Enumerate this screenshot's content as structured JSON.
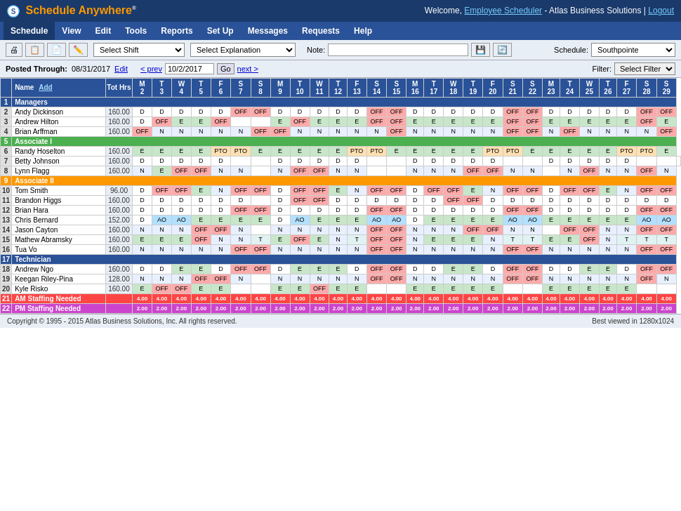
{
  "header": {
    "logo_text": "Schedule Anywhere",
    "logo_symbol": "®",
    "welcome_text": "Welcome,",
    "employee_scheduler": "Employee Scheduler",
    "company": "Atlas Business Solutions",
    "logout": "Logout"
  },
  "nav": {
    "items": [
      "Schedule",
      "View",
      "Edit",
      "Tools",
      "Reports",
      "Set Up",
      "Messages",
      "Requests",
      "Help"
    ]
  },
  "toolbar": {
    "shift_placeholder": "Select Shift",
    "explanation_placeholder": "Select Explanation",
    "note_label": "Note:",
    "icons": [
      "print-icon",
      "copy-icon",
      "paste-icon",
      "edit-icon"
    ]
  },
  "posted": {
    "label": "Posted Through:",
    "date": "08/31/2017",
    "edit": "Edit",
    "prev": "< prev",
    "current_date": "10/2/2017",
    "next": "next >",
    "go": "Go"
  },
  "schedule_section": {
    "label": "Schedule:",
    "value": "Southpointe"
  },
  "filter": {
    "label": "Filter:",
    "placeholder": "Select Filter"
  },
  "table": {
    "headers": {
      "name": "Name",
      "add": "Add",
      "tot_hrs": "Tot Hrs",
      "days": [
        {
          "day": "M",
          "date": "2"
        },
        {
          "day": "T",
          "date": "3"
        },
        {
          "day": "W",
          "date": "4"
        },
        {
          "day": "T",
          "date": "5"
        },
        {
          "day": "F",
          "date": "6"
        },
        {
          "day": "S",
          "date": "7"
        },
        {
          "day": "S",
          "date": "8"
        },
        {
          "day": "M",
          "date": "9"
        },
        {
          "day": "T",
          "date": "10"
        },
        {
          "day": "W",
          "date": "11"
        },
        {
          "day": "T",
          "date": "12"
        },
        {
          "day": "F",
          "date": "13"
        },
        {
          "day": "S",
          "date": "14"
        },
        {
          "day": "S",
          "date": "15"
        },
        {
          "day": "M",
          "date": "16"
        },
        {
          "day": "T",
          "date": "17"
        },
        {
          "day": "W",
          "date": "18"
        },
        {
          "day": "T",
          "date": "19"
        },
        {
          "day": "F",
          "date": "20"
        },
        {
          "day": "S",
          "date": "21"
        },
        {
          "day": "S",
          "date": "22"
        },
        {
          "day": "M",
          "date": "23"
        },
        {
          "day": "T",
          "date": "24"
        },
        {
          "day": "W",
          "date": "25"
        },
        {
          "day": "T",
          "date": "26"
        },
        {
          "day": "F",
          "date": "27"
        },
        {
          "day": "S",
          "date": "28"
        },
        {
          "day": "S",
          "date": "29"
        }
      ]
    },
    "sections": [
      {
        "type": "section",
        "label": "Managers",
        "color": "#2a5298"
      },
      {
        "type": "employee",
        "num": 2,
        "name": "Andy Dickinson",
        "tot_hrs": "160.00",
        "cells": [
          "D",
          "D",
          "D",
          "D",
          "D",
          "OFF",
          "OFF",
          "D",
          "D",
          "D",
          "D",
          "D",
          "OFF",
          "OFF",
          "D",
          "D",
          "D",
          "D",
          "D",
          "OFF",
          "OFF",
          "D",
          "D",
          "D",
          "D",
          "D",
          "OFF",
          "OFF"
        ]
      },
      {
        "type": "employee",
        "num": 3,
        "name": "Andrew Hilton",
        "tot_hrs": "160.00",
        "cells": [
          "D",
          "OFF",
          "E",
          "E",
          "OFF",
          "",
          "",
          "E",
          "OFF",
          "E",
          "E",
          "E",
          "OFF",
          "OFF",
          "E",
          "E",
          "E",
          "E",
          "E",
          "OFF",
          "OFF",
          "E",
          "E",
          "E",
          "E",
          "E",
          "OFF",
          "E"
        ]
      },
      {
        "type": "employee",
        "num": 4,
        "name": "Brian Arffman",
        "tot_hrs": "160.00",
        "cells": [
          "OFF",
          "N",
          "N",
          "N",
          "N",
          "N",
          "OFF",
          "OFF",
          "N",
          "N",
          "N",
          "N",
          "N",
          "OFF",
          "N",
          "N",
          "N",
          "N",
          "N",
          "OFF",
          "OFF",
          "N",
          "OFF",
          "N",
          "N",
          "N",
          "N",
          "OFF"
        ]
      },
      {
        "type": "section",
        "label": "Associate I",
        "color": "#4caf50"
      },
      {
        "type": "employee",
        "num": 6,
        "name": "Randy Hoselton",
        "tot_hrs": "160.00",
        "cells": [
          "E",
          "E",
          "E",
          "E",
          "PTO",
          "PTO",
          "E",
          "E",
          "E",
          "E",
          "E",
          "PTO",
          "PTO",
          "E",
          "E",
          "E",
          "E",
          "E",
          "PTO",
          "PTO",
          "E",
          "E",
          "E",
          "E",
          "E",
          "PTO",
          "PTO",
          "E"
        ]
      },
      {
        "type": "employee",
        "num": 7,
        "name": "Betty Johnson",
        "tot_hrs": "160.00",
        "cells": [
          "D",
          "D",
          "D",
          "D",
          "D",
          "",
          "",
          "D",
          "D",
          "D",
          "D",
          "D",
          "",
          "",
          "D",
          "D",
          "D",
          "D",
          "D",
          "",
          "",
          "D",
          "D",
          "D",
          "D",
          "D",
          "",
          "",
          ""
        ]
      },
      {
        "type": "employee",
        "num": 8,
        "name": "Lynn Flagg",
        "tot_hrs": "160.00",
        "cells": [
          "N",
          "E",
          "OFF",
          "OFF",
          "N",
          "N",
          "",
          "N",
          "OFF",
          "OFF",
          "N",
          "N",
          "",
          "",
          "N",
          "N",
          "N",
          "OFF",
          "OFF",
          "N",
          "N",
          "",
          "N",
          "OFF",
          "N",
          "N",
          "OFF",
          "N"
        ]
      },
      {
        "type": "section",
        "label": "Associate II",
        "color": "#ff9800"
      },
      {
        "type": "employee",
        "num": 10,
        "name": "Tom Smith",
        "tot_hrs": "96.00",
        "cells": [
          "D",
          "OFF",
          "OFF",
          "E",
          "N",
          "OFF",
          "OFF",
          "D",
          "OFF",
          "OFF",
          "E",
          "N",
          "OFF",
          "OFF",
          "D",
          "OFF",
          "OFF",
          "E",
          "N",
          "OFF",
          "OFF",
          "D",
          "OFF",
          "OFF",
          "E",
          "N",
          "OFF",
          "OFF"
        ]
      },
      {
        "type": "employee",
        "num": 11,
        "name": "Brandon Higgs",
        "tot_hrs": "160.00",
        "cells": [
          "D",
          "D",
          "D",
          "D",
          "D",
          "D",
          "",
          "D",
          "OFF",
          "OFF",
          "D",
          "D",
          "D",
          "D",
          "D",
          "D",
          "OFF",
          "OFF",
          "D",
          "D",
          "D",
          "D",
          "D",
          "D",
          "D",
          "D",
          "D",
          "D"
        ]
      },
      {
        "type": "employee",
        "num": 12,
        "name": "Brian Hara",
        "tot_hrs": "160.00",
        "cells": [
          "D",
          "D",
          "D",
          "D",
          "D",
          "OFF",
          "OFF",
          "D",
          "D",
          "D",
          "D",
          "D",
          "OFF",
          "OFF",
          "D",
          "D",
          "D",
          "D",
          "D",
          "OFF",
          "OFF",
          "D",
          "D",
          "D",
          "D",
          "D",
          "OFF",
          "OFF"
        ]
      },
      {
        "type": "employee",
        "num": 13,
        "name": "Chris Bernard",
        "tot_hrs": "152.00",
        "cells": [
          "D",
          "AO",
          "AO",
          "E",
          "E",
          "E",
          "E",
          "D",
          "AO",
          "E",
          "E",
          "E",
          "AO",
          "AO",
          "D",
          "E",
          "E",
          "E",
          "E",
          "AO",
          "AO",
          "E",
          "E",
          "E",
          "E",
          "E",
          "AO",
          "AO"
        ]
      },
      {
        "type": "employee",
        "num": 14,
        "name": "Jason Cayton",
        "tot_hrs": "160.00",
        "cells": [
          "N",
          "N",
          "N",
          "OFF",
          "OFF",
          "N",
          "",
          "N",
          "N",
          "N",
          "N",
          "N",
          "OFF",
          "OFF",
          "N",
          "N",
          "N",
          "OFF",
          "OFF",
          "N",
          "N",
          "",
          "OFF",
          "OFF",
          "N",
          "N",
          "OFF",
          "OFF"
        ]
      },
      {
        "type": "employee",
        "num": 15,
        "name": "Mathew Abramsky",
        "tot_hrs": "160.00",
        "cells": [
          "E",
          "E",
          "E",
          "OFF",
          "N",
          "N",
          "T",
          "E",
          "OFF",
          "E",
          "N",
          "T",
          "OFF",
          "OFF",
          "N",
          "E",
          "E",
          "E",
          "N",
          "T",
          "T",
          "E",
          "E",
          "OFF",
          "N",
          "T",
          "T",
          "T"
        ]
      },
      {
        "type": "employee",
        "num": 16,
        "name": "Tua Vo",
        "tot_hrs": "160.00",
        "cells": [
          "N",
          "N",
          "N",
          "N",
          "N",
          "OFF",
          "OFF",
          "N",
          "N",
          "N",
          "N",
          "N",
          "OFF",
          "OFF",
          "N",
          "N",
          "N",
          "N",
          "N",
          "OFF",
          "OFF",
          "N",
          "N",
          "N",
          "N",
          "N",
          "OFF",
          "OFF"
        ]
      },
      {
        "type": "section",
        "label": "Technician",
        "color": "#2a5298"
      },
      {
        "type": "employee",
        "num": 18,
        "name": "Andrew Ngo",
        "tot_hrs": "160.00",
        "cells": [
          "D",
          "D",
          "E",
          "E",
          "D",
          "OFF",
          "OFF",
          "D",
          "E",
          "E",
          "E",
          "D",
          "OFF",
          "OFF",
          "D",
          "D",
          "E",
          "E",
          "D",
          "OFF",
          "OFF",
          "D",
          "D",
          "E",
          "E",
          "D",
          "OFF",
          "OFF"
        ]
      },
      {
        "type": "employee",
        "num": 19,
        "name": "Keegan Riley-Pina",
        "tot_hrs": "128.00",
        "cells": [
          "N",
          "N",
          "N",
          "OFF",
          "OFF",
          "N",
          "",
          "N",
          "N",
          "N",
          "N",
          "N",
          "OFF",
          "OFF",
          "N",
          "N",
          "N",
          "N",
          "N",
          "OFF",
          "OFF",
          "N",
          "N",
          "N",
          "N",
          "N",
          "OFF",
          "N"
        ]
      },
      {
        "type": "employee",
        "num": 20,
        "name": "Kyle Risko",
        "tot_hrs": "160.00",
        "cells": [
          "E",
          "OFF",
          "OFF",
          "E",
          "E",
          "",
          "",
          "E",
          "E",
          "OFF",
          "E",
          "E",
          "",
          "",
          "E",
          "E",
          "E",
          "E",
          "E",
          "",
          "",
          "E",
          "E",
          "E",
          "E",
          "E",
          "",
          ""
        ]
      }
    ],
    "staffing_rows": {
      "am_label": "AM Staffing Needed",
      "pm_label": "PM Staffing Needed",
      "am_num": 21,
      "pm_num": 22,
      "am_values": [
        "4.00",
        "4.00",
        "4.00",
        "4.00",
        "4.00",
        "4.00",
        "4.00",
        "4.00",
        "4.00",
        "4.00",
        "4.00",
        "4.00",
        "4.00",
        "4.00",
        "4.00",
        "4.00",
        "4.00",
        "4.00",
        "4.00",
        "4.00",
        "4.00",
        "4.00",
        "4.00",
        "4.00",
        "4.00",
        "4.00",
        "4.00",
        "4.00"
      ],
      "pm_values": [
        "2.00",
        "2.00",
        "2.00",
        "2.00",
        "2.00",
        "2.00",
        "2.00",
        "2.00",
        "2.00",
        "2.00",
        "2.00",
        "2.00",
        "2.00",
        "2.00",
        "2.00",
        "2.00",
        "2.00",
        "2.00",
        "2.00",
        "2.00",
        "2.00",
        "2.00",
        "2.00",
        "2.00",
        "2.00",
        "2.00",
        "2.00",
        "2.00"
      ]
    }
  },
  "footer": {
    "copyright": "Copyright © 1995 - 2015 Atlas Business Solutions, Inc. All rights reserved.",
    "best_viewed": "Best viewed in 1280x1024"
  }
}
